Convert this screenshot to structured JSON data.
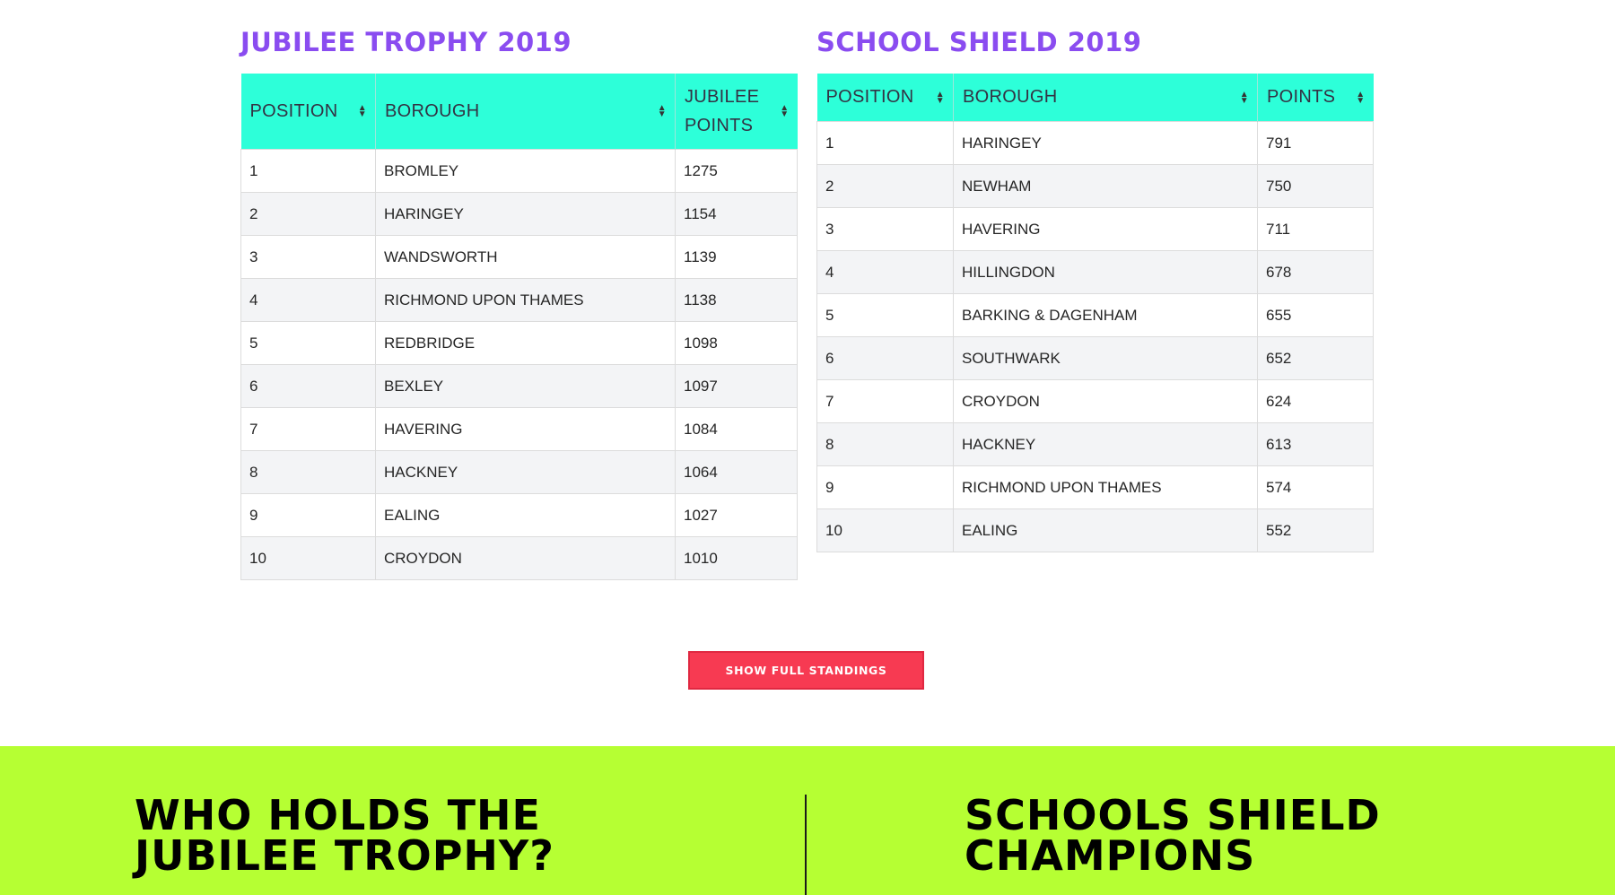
{
  "jubilee": {
    "title": "JUBILEE TROPHY 2019",
    "headers": [
      "POSITION",
      "BOROUGH",
      "JUBILEE POINTS"
    ],
    "rows": [
      [
        "1",
        "BROMLEY",
        "1275"
      ],
      [
        "2",
        "HARINGEY",
        "1154"
      ],
      [
        "3",
        "WANDSWORTH",
        "1139"
      ],
      [
        "4",
        "RICHMOND UPON THAMES",
        "1138"
      ],
      [
        "5",
        "REDBRIDGE",
        "1098"
      ],
      [
        "6",
        "BEXLEY",
        "1097"
      ],
      [
        "7",
        "HAVERING",
        "1084"
      ],
      [
        "8",
        "HACKNEY",
        "1064"
      ],
      [
        "9",
        "EALING",
        "1027"
      ],
      [
        "10",
        "CROYDON",
        "1010"
      ]
    ]
  },
  "shield": {
    "title": "SCHOOL SHIELD 2019",
    "headers": [
      "POSITION",
      "BOROUGH",
      "POINTS"
    ],
    "rows": [
      [
        "1",
        "HARINGEY",
        "791"
      ],
      [
        "2",
        "NEWHAM",
        "750"
      ],
      [
        "3",
        "HAVERING",
        "711"
      ],
      [
        "4",
        "HILLINGDON",
        "678"
      ],
      [
        "5",
        "BARKING & DAGENHAM",
        "655"
      ],
      [
        "6",
        "SOUTHWARK",
        "652"
      ],
      [
        "7",
        "CROYDON",
        "624"
      ],
      [
        "8",
        "HACKNEY",
        "613"
      ],
      [
        "9",
        "RICHMOND UPON THAMES",
        "574"
      ],
      [
        "10",
        "EALING",
        "552"
      ]
    ]
  },
  "show_full_button": "SHOW FULL STANDINGS",
  "band": {
    "left_heading_line1": "WHO HOLDS THE",
    "left_heading_line2": "JUBILEE TROPHY?",
    "right_heading_line1": "SCHOOLS SHIELD",
    "right_heading_line2": "CHAMPIONS"
  },
  "colors": {
    "title": "#8a4cf0",
    "table_header": "#2dffd9",
    "button": "#f73a52",
    "band": "#b6ff33"
  },
  "icons": {
    "sort": "sort-icon"
  }
}
